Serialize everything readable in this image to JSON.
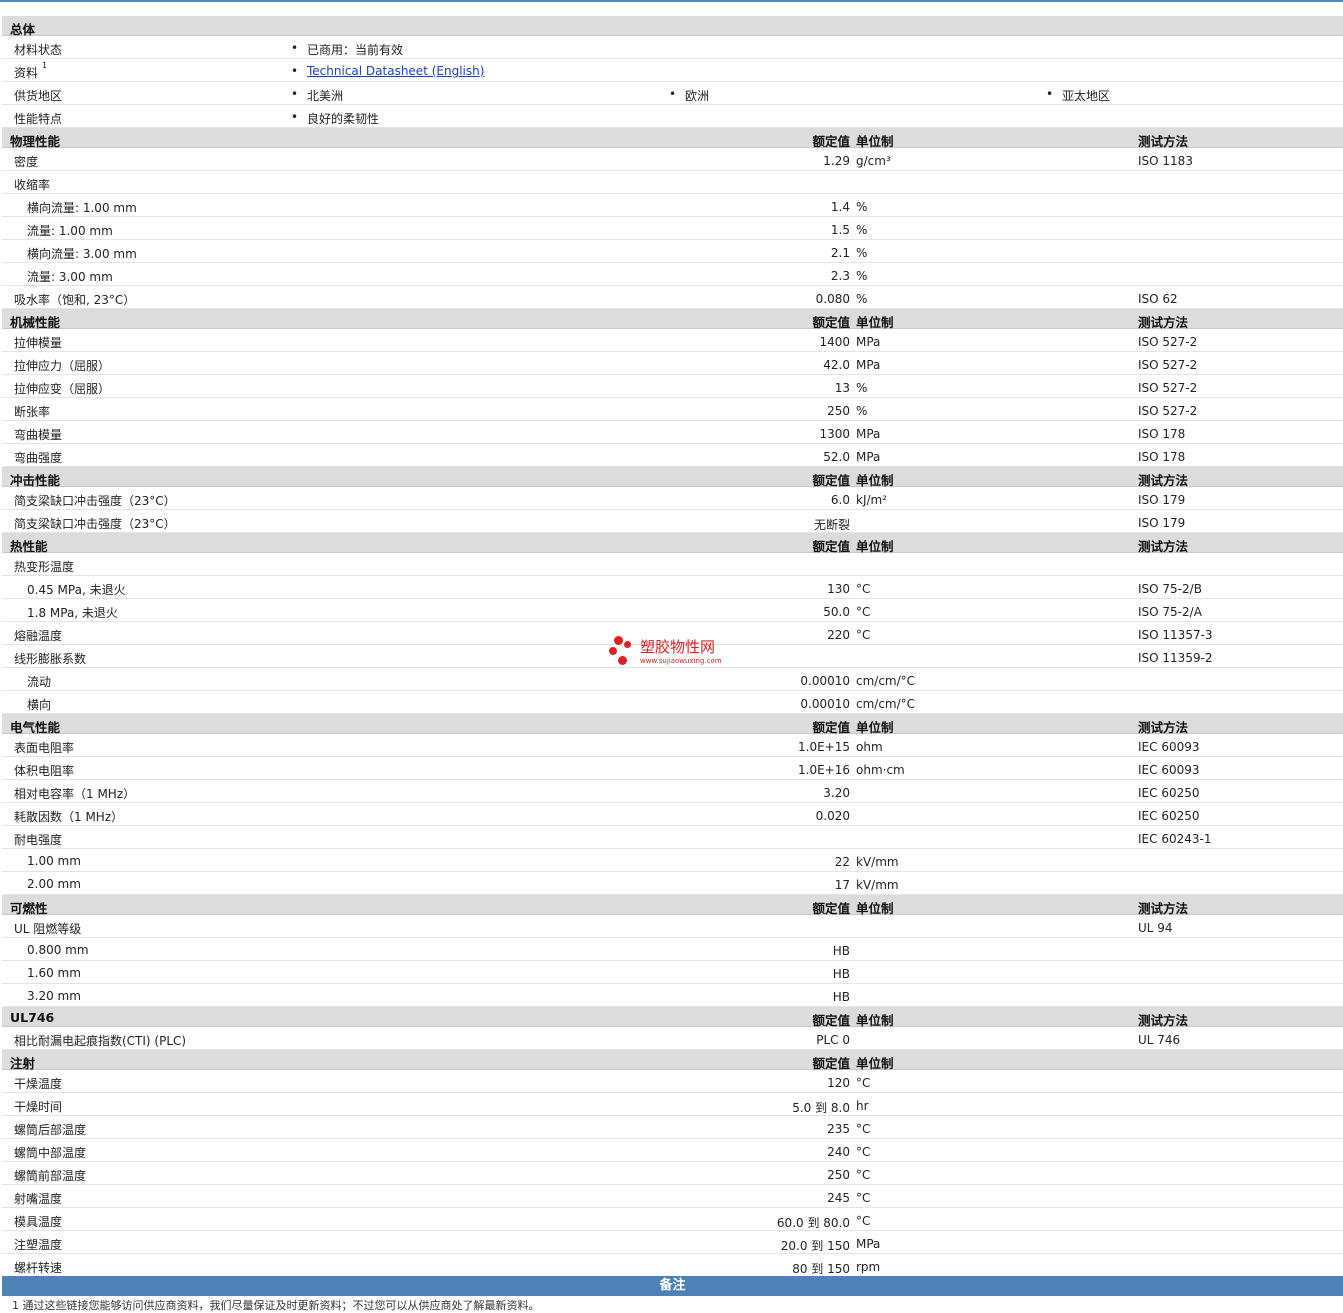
{
  "general": {
    "title": "总体",
    "rows": [
      {
        "name": "材料状态",
        "cols": [
          "已商用：当前有效"
        ]
      },
      {
        "name": "资料",
        "sup": "1",
        "cols": [
          "Technical Datasheet (English)"
        ],
        "link": true
      },
      {
        "name": "供货地区",
        "cols": [
          "北美洲",
          "欧洲",
          "亚太地区"
        ]
      },
      {
        "name": "性能特点",
        "cols": [
          "良好的柔韧性"
        ]
      }
    ]
  },
  "headers": {
    "value": "额定值",
    "unit": "单位制",
    "method": "测试方法"
  },
  "sections": [
    {
      "title": "物理性能",
      "rows": [
        {
          "name": "密度",
          "value": "1.29",
          "unit": "g/cm³",
          "method": "ISO 1183"
        },
        {
          "name": "收缩率",
          "value": "",
          "unit": "",
          "method": ""
        },
        {
          "name": "横向流量: 1.00 mm",
          "value": "1.4",
          "unit": "%",
          "method": "",
          "sub": true
        },
        {
          "name": "流量: 1.00 mm",
          "value": "1.5",
          "unit": "%",
          "method": "",
          "sub": true
        },
        {
          "name": "横向流量: 3.00 mm",
          "value": "2.1",
          "unit": "%",
          "method": "",
          "sub": true
        },
        {
          "name": "流量: 3.00 mm",
          "value": "2.3",
          "unit": "%",
          "method": "",
          "sub": true
        },
        {
          "name": "吸水率（饱和, 23°C）",
          "value": "0.080",
          "unit": "%",
          "method": "ISO 62"
        }
      ]
    },
    {
      "title": "机械性能",
      "rows": [
        {
          "name": "拉伸模量",
          "value": "1400",
          "unit": "MPa",
          "method": "ISO 527-2"
        },
        {
          "name": "拉伸应力（屈服）",
          "value": "42.0",
          "unit": "MPa",
          "method": "ISO 527-2"
        },
        {
          "name": "拉伸应变（屈服）",
          "value": "13",
          "unit": "%",
          "method": "ISO 527-2"
        },
        {
          "name": "断张率",
          "value": "250",
          "unit": "%",
          "method": "ISO 527-2"
        },
        {
          "name": "弯曲模量",
          "value": "1300",
          "unit": "MPa",
          "method": "ISO 178"
        },
        {
          "name": "弯曲强度",
          "value": "52.0",
          "unit": "MPa",
          "method": "ISO 178"
        }
      ]
    },
    {
      "title": "冲击性能",
      "rows": [
        {
          "name": "简支梁缺口冲击强度（23°C）",
          "value": "6.0",
          "unit": "kJ/m²",
          "method": "ISO 179"
        },
        {
          "name": "简支梁缺口冲击强度（23°C）",
          "value": "无断裂",
          "unit": "",
          "method": "ISO 179"
        }
      ]
    },
    {
      "title": "热性能",
      "rows": [
        {
          "name": "热变形温度",
          "value": "",
          "unit": "",
          "method": ""
        },
        {
          "name": "0.45 MPa, 未退火",
          "value": "130",
          "unit": "°C",
          "method": "ISO 75-2/B",
          "sub": true
        },
        {
          "name": "1.8 MPa, 未退火",
          "value": "50.0",
          "unit": "°C",
          "method": "ISO 75-2/A",
          "sub": true
        },
        {
          "name": "熔融温度",
          "value": "220",
          "unit": "°C",
          "method": "ISO 11357-3"
        },
        {
          "name": "线形膨胀系数",
          "value": "",
          "unit": "",
          "method": "ISO 11359-2"
        },
        {
          "name": "流动",
          "value": "0.00010",
          "unit": "cm/cm/°C",
          "method": "",
          "sub": true
        },
        {
          "name": "横向",
          "value": "0.00010",
          "unit": "cm/cm/°C",
          "method": "",
          "sub": true
        }
      ]
    },
    {
      "title": "电气性能",
      "rows": [
        {
          "name": "表面电阻率",
          "value": "1.0E+15",
          "unit": "ohm",
          "method": "IEC 60093"
        },
        {
          "name": "体积电阻率",
          "value": "1.0E+16",
          "unit": "ohm·cm",
          "method": "IEC 60093"
        },
        {
          "name": "相对电容率（1 MHz）",
          "value": "3.20",
          "unit": "",
          "method": "IEC 60250"
        },
        {
          "name": "耗散因数（1 MHz）",
          "value": "0.020",
          "unit": "",
          "method": "IEC 60250"
        },
        {
          "name": "耐电强度",
          "value": "",
          "unit": "",
          "method": "IEC 60243-1"
        },
        {
          "name": "1.00 mm",
          "value": "22",
          "unit": "kV/mm",
          "method": "",
          "sub": true
        },
        {
          "name": "2.00 mm",
          "value": "17",
          "unit": "kV/mm",
          "method": "",
          "sub": true
        }
      ]
    },
    {
      "title": "可燃性",
      "rows": [
        {
          "name": "UL 阻燃等级",
          "value": "",
          "unit": "",
          "method": "UL 94"
        },
        {
          "name": "0.800 mm",
          "value": "HB",
          "unit": "",
          "method": "",
          "sub": true
        },
        {
          "name": "1.60 mm",
          "value": "HB",
          "unit": "",
          "method": "",
          "sub": true
        },
        {
          "name": "3.20 mm",
          "value": "HB",
          "unit": "",
          "method": "",
          "sub": true
        }
      ]
    },
    {
      "title": "UL746",
      "rows": [
        {
          "name": "相比耐漏电起痕指数(CTI) (PLC)",
          "value": "PLC 0",
          "unit": "",
          "method": "UL 746"
        }
      ]
    },
    {
      "title": "注射",
      "noMethod": true,
      "rows": [
        {
          "name": "干燥温度",
          "value": "120",
          "unit": "°C",
          "method": ""
        },
        {
          "name": "干燥时间",
          "value": "5.0 到  8.0",
          "unit": "hr",
          "method": ""
        },
        {
          "name": "螺筒后部温度",
          "value": "235",
          "unit": "°C",
          "method": ""
        },
        {
          "name": "螺筒中部温度",
          "value": "240",
          "unit": "°C",
          "method": ""
        },
        {
          "name": "螺筒前部温度",
          "value": "250",
          "unit": "°C",
          "method": ""
        },
        {
          "name": "射嘴温度",
          "value": "245",
          "unit": "°C",
          "method": ""
        },
        {
          "name": "模具温度",
          "value": "60.0 到  80.0",
          "unit": "°C",
          "method": ""
        },
        {
          "name": "注塑温度",
          "value": "20.0 到  150",
          "unit": "MPa",
          "method": ""
        },
        {
          "name": "螺杆转速",
          "value": "80 到  150",
          "unit": "rpm",
          "method": ""
        }
      ]
    }
  ],
  "notes": {
    "title": "备注",
    "footnote": "1  通过这些链接您能够访问供应商资料，我们尽量保证及时更新资料；不过您可以从供应商处了解最新资料。"
  },
  "watermark": {
    "name": "塑胶物性网",
    "url": "www.sujiaowuxing.com"
  }
}
